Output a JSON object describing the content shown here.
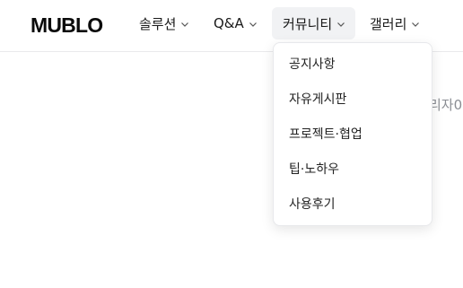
{
  "header": {
    "logo": "MUBLO",
    "nav": [
      {
        "label": "솔루션",
        "icon": "chevron-down-icon",
        "active": false
      },
      {
        "label": "Q&A",
        "icon": "chevron-down-icon",
        "active": false
      },
      {
        "label": "커뮤니티",
        "icon": "chevron-down-icon",
        "active": true
      },
      {
        "label": "갤러리",
        "icon": "chevron-down-icon",
        "active": false
      }
    ]
  },
  "dropdown": {
    "items": [
      {
        "label": "공지사항"
      },
      {
        "label": "자유게시판"
      },
      {
        "label": "프로젝트·협업"
      },
      {
        "label": "팁·노하우"
      },
      {
        "label": "사용후기"
      }
    ]
  },
  "background": {
    "partial_text": "리자0"
  },
  "colors": {
    "active_bg": "#f1f2f4",
    "header_border": "#e9e9ec",
    "muted_text": "#8a8d93"
  }
}
